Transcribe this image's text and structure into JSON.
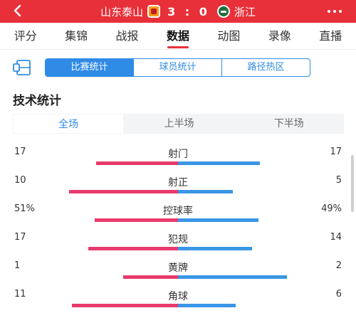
{
  "header": {
    "home_team": "山东泰山",
    "score": "3 : 0",
    "away_team": "浙江",
    "bg_color": "#e8303a"
  },
  "nav": {
    "tabs": [
      "评分",
      "集锦",
      "战报",
      "数据",
      "动图",
      "录像",
      "直播"
    ],
    "active": "数据"
  },
  "segment": {
    "options": [
      "比赛统计",
      "球员统计",
      "路径热区"
    ],
    "active": "比赛统计",
    "accent": "#2f8be6"
  },
  "section_title": "技术统计",
  "half_tabs": {
    "options": [
      "全场",
      "上半场",
      "下半场"
    ],
    "active": "全场"
  },
  "stats": [
    {
      "label": "射门",
      "home": "17",
      "away": "17",
      "home_ratio": 0.5,
      "away_ratio": 0.5
    },
    {
      "label": "射正",
      "home": "10",
      "away": "5",
      "home_ratio": 0.667,
      "away_ratio": 0.333
    },
    {
      "label": "控球率",
      "home": "51%",
      "away": "49%",
      "home_ratio": 0.51,
      "away_ratio": 0.49
    },
    {
      "label": "犯规",
      "home": "17",
      "away": "14",
      "home_ratio": 0.548,
      "away_ratio": 0.452
    },
    {
      "label": "黄牌",
      "home": "1",
      "away": "2",
      "home_ratio": 0.333,
      "away_ratio": 0.667
    },
    {
      "label": "角球",
      "home": "11",
      "away": "6",
      "home_ratio": 0.647,
      "away_ratio": 0.353
    }
  ],
  "colors": {
    "home_bar": "#e83a6e",
    "away_bar": "#3a96e6"
  }
}
